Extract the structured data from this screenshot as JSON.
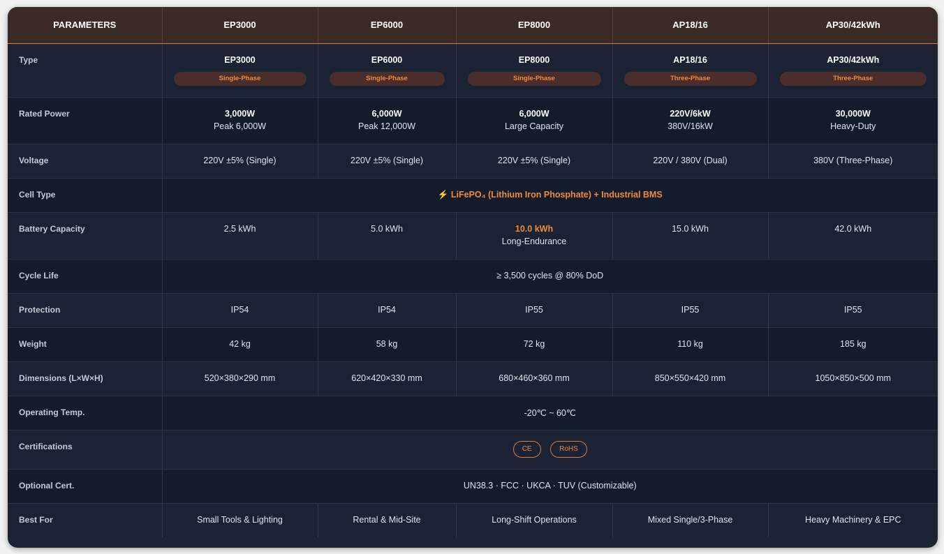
{
  "header": {
    "parameters": "PARAMETERS",
    "models": [
      "EP3000",
      "EP6000",
      "EP8000",
      "AP18/16",
      "AP30/42kWh"
    ]
  },
  "rows": {
    "type": {
      "label": "Type",
      "models": [
        "EP3000",
        "EP6000",
        "EP8000",
        "AP18/16",
        "AP30/42kWh"
      ],
      "phases": [
        "Single-Phase",
        "Single-Phase",
        "Single-Phase",
        "Three-Phase",
        "Three-Phase"
      ]
    },
    "rated_power": {
      "label": "Rated Power",
      "main": [
        "3,000W",
        "6,000W",
        "6,000W",
        "220V/6kW",
        "30,000W"
      ],
      "sub": [
        "Peak 6,000W",
        "Peak 12,000W",
        "Large Capacity",
        "380V/16kW",
        "Heavy-Duty"
      ]
    },
    "voltage": {
      "label": "Voltage",
      "values": [
        "220V ±5% (Single)",
        "220V ±5% (Single)",
        "220V ±5% (Single)",
        "220V / 380V (Dual)",
        "380V (Three-Phase)"
      ]
    },
    "cell_type": {
      "label": "Cell Type",
      "value": "⚡ LiFePO₄ (Lithium Iron Phosphate) + Industrial BMS"
    },
    "battery_capacity": {
      "label": "Battery Capacity",
      "values": [
        "2.5 kWh",
        "5.0 kWh",
        "10.0 kWh",
        "15.0 kWh",
        "42.0 kWh"
      ],
      "highlight_sub": "Long-Endurance"
    },
    "cycle_life": {
      "label": "Cycle Life",
      "value": "≥ 3,500 cycles @ 80% DoD"
    },
    "protection": {
      "label": "Protection",
      "values": [
        "IP54",
        "IP54",
        "IP55",
        "IP55",
        "IP55"
      ]
    },
    "weight": {
      "label": "Weight",
      "values": [
        "42 kg",
        "58 kg",
        "72 kg",
        "110 kg",
        "185 kg"
      ]
    },
    "dimensions": {
      "label": "Dimensions (L×W×H)",
      "values": [
        "520×380×290 mm",
        "620×420×330 mm",
        "680×460×360 mm",
        "850×550×420 mm",
        "1050×850×500 mm"
      ]
    },
    "operating_temp": {
      "label": "Operating Temp.",
      "value": "-20℃ ~ 60℃"
    },
    "certifications": {
      "label": "Certifications",
      "badges": [
        "CE",
        "RoHS"
      ]
    },
    "optional_cert": {
      "label": "Optional Cert.",
      "value": "UN38.3 · FCC · UKCA · TUV (Customizable)"
    },
    "best_for": {
      "label": "Best For",
      "values": [
        "Small Tools & Lighting",
        "Rental & Mid-Site",
        "Long-Shift Operations",
        "Mixed Single/3-Phase",
        "Heavy Machinery & EPC"
      ]
    }
  },
  "colors": {
    "accent": "#f08a3c",
    "header_bg": "#3b2a25",
    "table_bg": "#1a2233",
    "page_bg": "#f1f1f1"
  }
}
